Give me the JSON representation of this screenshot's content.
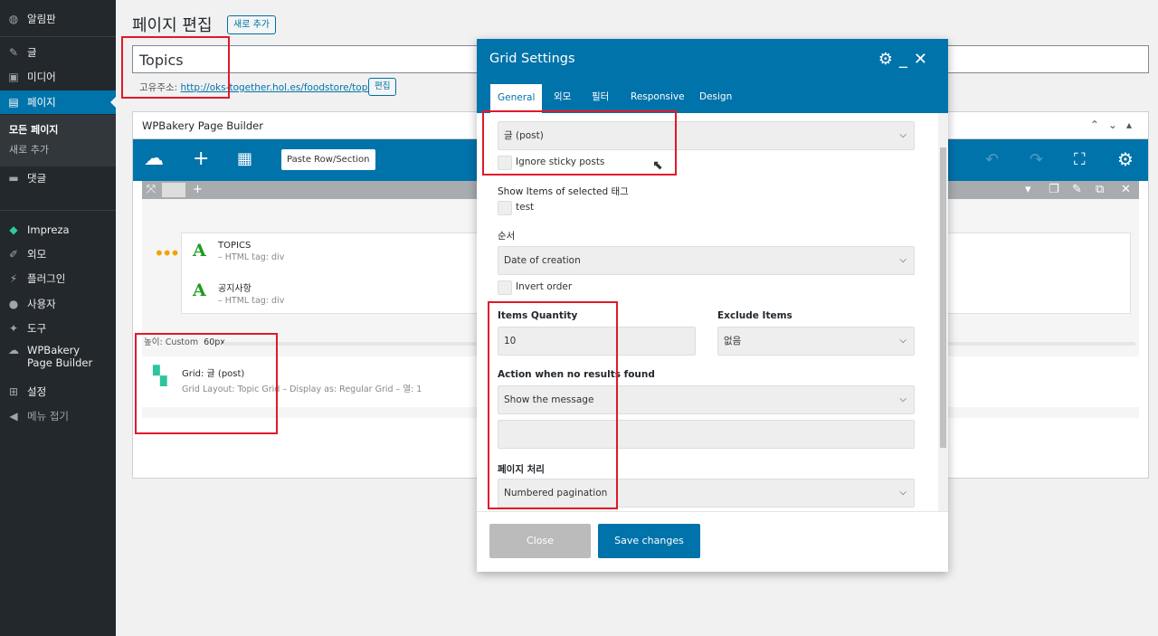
{
  "sidebar": {
    "items": [
      {
        "label": "알림판",
        "icon": "dashboard-icon"
      },
      {
        "label": "글",
        "icon": "pin-icon"
      },
      {
        "label": "미디어",
        "icon": "media-icon"
      },
      {
        "label": "페이지",
        "icon": "page-icon"
      },
      {
        "label": "댓글",
        "icon": "comment-icon"
      },
      {
        "label": "Impreza",
        "icon": "diamond-icon"
      },
      {
        "label": "외모",
        "icon": "brush-icon"
      },
      {
        "label": "플러그인",
        "icon": "plugin-icon"
      },
      {
        "label": "사용자",
        "icon": "user-icon"
      },
      {
        "label": "도구",
        "icon": "wrench-icon"
      },
      {
        "label": "WPBakery Page Builder",
        "icon": "cloud-icon"
      },
      {
        "label": "설정",
        "icon": "settings-icon"
      },
      {
        "label": "메뉴 접기",
        "icon": "collapse-icon"
      }
    ],
    "submenu": {
      "all_pages": "모든 페이지",
      "add_new": "새로 추가"
    }
  },
  "page": {
    "heading": "페이지 편집",
    "add_new": "새로 추가",
    "title_value": "Topics",
    "permalink_label": "고유주소:",
    "permalink_url": "http://oks-together.hol.es/foodstore/topics/",
    "edit_button": "편집"
  },
  "builder": {
    "title": "WPBakery Page Builder",
    "paste_button": "Paste Row/Section",
    "elements": [
      {
        "title": "TOPICS",
        "sub": "– HTML tag: div"
      },
      {
        "title": "공지사항",
        "sub": "– HTML tag: div"
      }
    ],
    "height_label": "높이: Custom",
    "height_value": "60px",
    "grid": {
      "title": "Grid: 글 (post)",
      "sub": "Grid Layout: Topic Grid – Display as: Regular Grid – 열: 1"
    }
  },
  "modal": {
    "title": "Grid Settings",
    "tabs": [
      "General",
      "외모",
      "필터",
      "Responsive",
      "Design"
    ],
    "post_type": "글 (post)",
    "ignore_sticky": "Ignore sticky posts",
    "show_items_label": "Show Items of selected 태그",
    "tag_option": "test",
    "order_label": "순서",
    "order_value": "Date of creation",
    "invert_order": "Invert order",
    "items_quantity_label": "Items Quantity",
    "items_quantity_value": "10",
    "exclude_label": "Exclude Items",
    "exclude_value": "없음",
    "no_results_label": "Action when no results found",
    "no_results_value": "Show the message",
    "pagination_label": "페이지 처리",
    "pagination_value": "Numbered pagination",
    "close": "Close",
    "save": "Save changes"
  },
  "colors": {
    "accent": "#0073aa",
    "sidebar": "#23282d",
    "highlight": "#e0192a"
  }
}
